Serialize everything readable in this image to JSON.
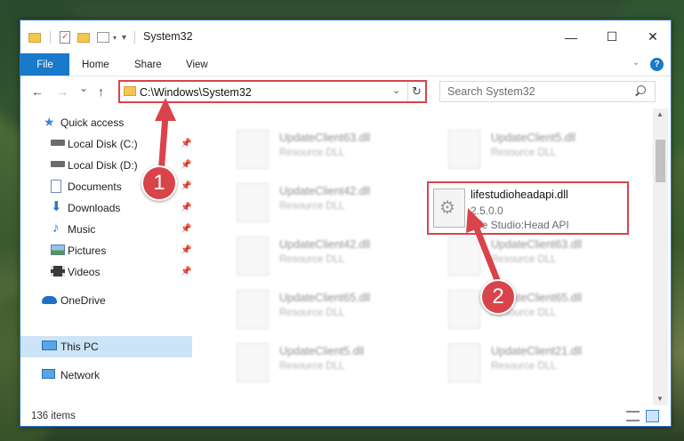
{
  "window": {
    "title": "System32",
    "controls": {
      "minimize": "—",
      "maximize": "☐",
      "close": "✕"
    }
  },
  "ribbon": {
    "tabs": [
      {
        "label": "File"
      },
      {
        "label": "Home"
      },
      {
        "label": "Share"
      },
      {
        "label": "View"
      }
    ],
    "help": "?"
  },
  "nav": {
    "back": "←",
    "forward": "→",
    "recent": "⌄",
    "up": "↑",
    "address": "C:\\Windows\\System32",
    "refresh": "↻",
    "search_placeholder": "Search System32"
  },
  "sidebar": {
    "items": [
      {
        "label": "Quick access",
        "icon": "star-icon",
        "pinned": false
      },
      {
        "label": "Local Disk (C:)",
        "icon": "drive-icon",
        "pinned": true
      },
      {
        "label": "Local Disk (D:)",
        "icon": "drive-icon",
        "pinned": true
      },
      {
        "label": "Documents",
        "icon": "documents-icon",
        "pinned": true
      },
      {
        "label": "Downloads",
        "icon": "downloads-icon",
        "pinned": true
      },
      {
        "label": "Music",
        "icon": "music-icon",
        "pinned": true
      },
      {
        "label": "Pictures",
        "icon": "pictures-icon",
        "pinned": true
      },
      {
        "label": "Videos",
        "icon": "videos-icon",
        "pinned": true
      },
      {
        "label": "OneDrive",
        "icon": "cloud-icon",
        "pinned": false
      },
      {
        "label": "This PC",
        "icon": "computer-icon",
        "pinned": false,
        "selected": true
      },
      {
        "label": "Network",
        "icon": "network-icon",
        "pinned": false
      }
    ]
  },
  "files": [
    {
      "name": "UpdateClient63.dll",
      "sub": "Resource DLL"
    },
    {
      "name": "UpdateClient5.dll",
      "sub": "Resource DLL"
    },
    {
      "name": "UpdateClient42.dll",
      "sub": "Resource DLL"
    },
    {
      "name": "UpdateClient42.dll",
      "sub": "Resource DLL"
    },
    {
      "name": "UpdateClient63.dll",
      "sub": "Resource DLL"
    },
    {
      "name": "UpdateClient65.dll",
      "sub": "Resource DLL"
    },
    {
      "name": "UpdateClient65.dll",
      "sub": "Resource DLL"
    },
    {
      "name": "UpdateClient5.dll",
      "sub": "Resource DLL"
    },
    {
      "name": "UpdateClient21.dll",
      "sub": "Resource DLL"
    }
  ],
  "highlighted_file": {
    "name": "lifestudioheadapi.dll",
    "version": "2.5.0.0",
    "description": "Life Studio:Head API"
  },
  "status": {
    "item_count": "136 items"
  },
  "callouts": [
    {
      "number": "1"
    },
    {
      "number": "2"
    }
  ],
  "colors": {
    "accent": "#1979ca",
    "highlight": "#d9434a",
    "selected": "#cce4f7"
  }
}
